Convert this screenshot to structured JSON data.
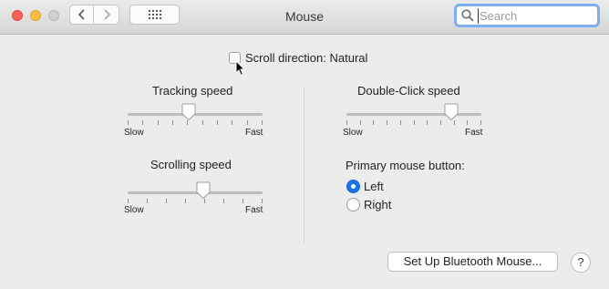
{
  "window": {
    "title": "Mouse"
  },
  "toolbar": {
    "back_icon": "chevron-left-icon",
    "forward_icon": "chevron-right-icon",
    "grid_icon": "grid-icon"
  },
  "search": {
    "placeholder": "Search",
    "value": ""
  },
  "scroll_direction": {
    "label": "Scroll direction: Natural",
    "checked": false
  },
  "tracking": {
    "label": "Tracking speed",
    "min_label": "Slow",
    "max_label": "Fast",
    "value": 0.45,
    "ticks": 10
  },
  "scrolling": {
    "label": "Scrolling speed",
    "min_label": "Slow",
    "max_label": "Fast",
    "value": 0.56,
    "ticks": 8
  },
  "double_click": {
    "label": "Double-Click speed",
    "min_label": "Slow",
    "max_label": "Fast",
    "value": 0.78,
    "ticks": 11
  },
  "primary_button": {
    "label": "Primary mouse button:",
    "options": [
      {
        "label": "Left",
        "selected": true
      },
      {
        "label": "Right",
        "selected": false
      }
    ]
  },
  "bluetooth_button": {
    "label": "Set Up Bluetooth Mouse..."
  },
  "help_button": {
    "label": "?"
  },
  "colors": {
    "accent": "#1a73e8",
    "search_focus": "#7eaef3"
  }
}
